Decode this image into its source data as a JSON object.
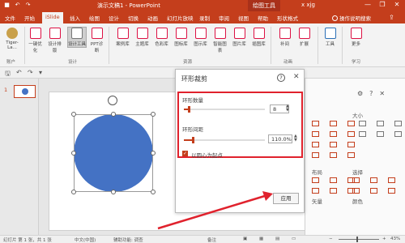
{
  "window": {
    "title": "演示文稿1 - PowerPoint",
    "drawing_tools": "绘图工具",
    "user": "x xjg",
    "minimize": "—",
    "restore": "❐",
    "close": "✕"
  },
  "tabs": [
    {
      "label": "文件"
    },
    {
      "label": "开始"
    },
    {
      "label": "iSlide"
    },
    {
      "label": "插入"
    },
    {
      "label": "绘图"
    },
    {
      "label": "设计"
    },
    {
      "label": "切换"
    },
    {
      "label": "动画"
    },
    {
      "label": "幻灯片放映"
    },
    {
      "label": "录制"
    },
    {
      "label": "审阅"
    },
    {
      "label": "视图"
    },
    {
      "label": "帮助"
    },
    {
      "label": "形状格式"
    }
  ],
  "search": {
    "label": "操作说明搜索"
  },
  "ribbon": {
    "account_label": "Tiger-La...",
    "buttons": {
      "onekey": "一键优化",
      "layout": "设计排版",
      "tools": "设计工具",
      "ppt_diag": "PPT诊断",
      "case": "案例库",
      "theme": "主题库",
      "color": "色彩库",
      "icon": "图标库",
      "chart": "图示库",
      "smartart": "智能图表",
      "picture": "图片库",
      "illus": "插图库",
      "animate": "补间",
      "expand": "扩展",
      "toolbox": "工具",
      "more": "更多"
    },
    "groups": {
      "account": "账户",
      "design": "设计",
      "resources": "资源",
      "animation": "动画",
      "learn": "学习"
    }
  },
  "thumbs": {
    "slide_number": "1"
  },
  "dialog": {
    "title": "环形裁剪",
    "help": "?",
    "close": "✕",
    "count_label": "环形数量",
    "count_value": "8",
    "count_fraction": 0.06,
    "spacing_label": "环形间距",
    "spacing_value": "110.0%",
    "spacing_fraction": 0.11,
    "checkbox_label": "以圆心为起点",
    "checkbox_checked": true,
    "apply_label": "应用"
  },
  "right_pane": {
    "size_label": "大小",
    "layout_label": "布局",
    "select_label": "选择",
    "vector_label": "矢量",
    "color_label": "颜色"
  },
  "status": {
    "slide_info": "幻灯片 第 1 张，共 1 张",
    "language": "中文(中国)",
    "accessibility": "辅助功能: 调查",
    "notes": "备注",
    "zoom": "43%"
  },
  "colors": {
    "accent": "#c43e1c",
    "shape_fill": "#4472c4",
    "highlight": "#e0222d"
  }
}
